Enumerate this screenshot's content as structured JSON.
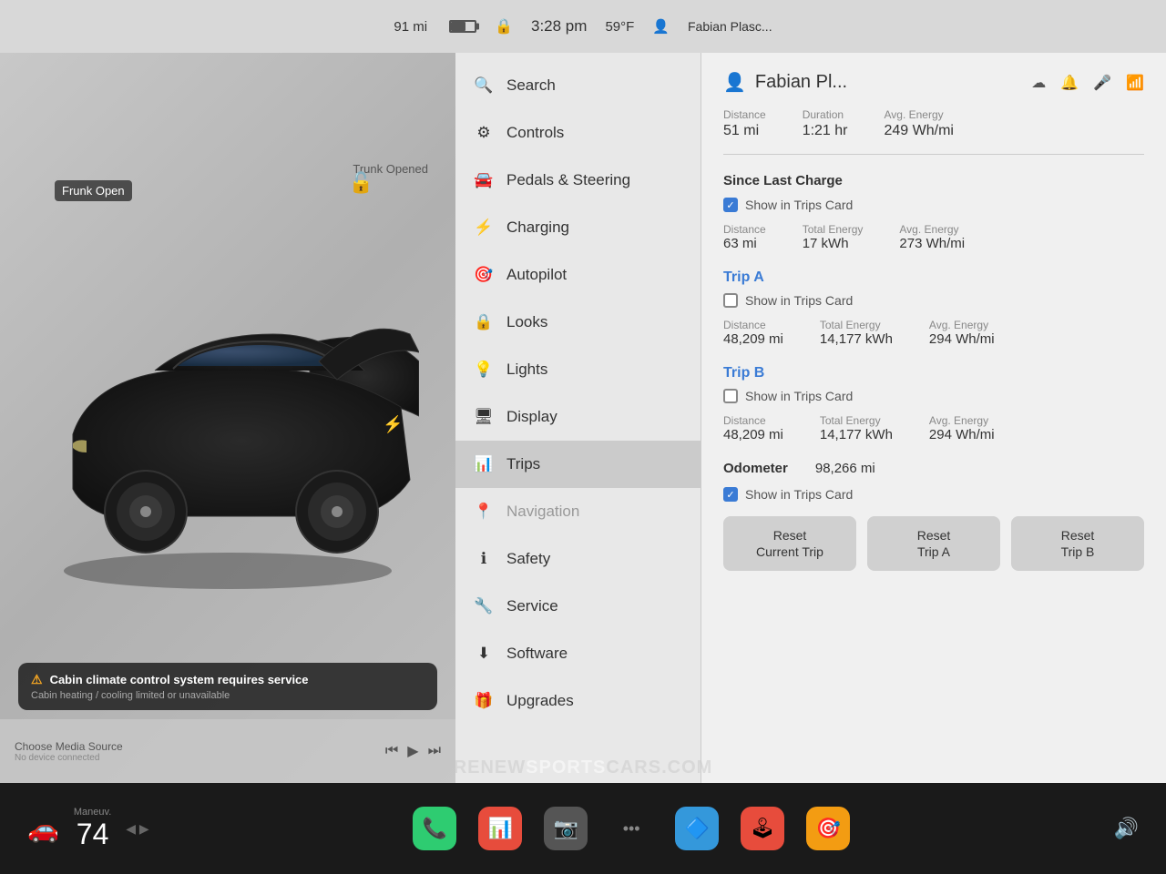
{
  "statusBar": {
    "range": "91 mi",
    "lock": "🔒",
    "time": "3:28 pm",
    "temp": "59°F",
    "user": "Fabian Plasc..."
  },
  "carPanel": {
    "frunkLabel": "Frunk\nOpen",
    "trunkLabel": "Trunk\nOpened",
    "alertTitle": "Cabin climate control system requires service",
    "alertSubtitle": "Cabin heating / cooling limited or unavailable",
    "mediaSource": "Choose Media Source",
    "mediaSubtitle": "No device connected"
  },
  "menu": {
    "items": [
      {
        "id": "search",
        "label": "Search",
        "icon": "🔍"
      },
      {
        "id": "controls",
        "label": "Controls",
        "icon": "🔘"
      },
      {
        "id": "pedals",
        "label": "Pedals & Steering",
        "icon": "🚗"
      },
      {
        "id": "charging",
        "label": "Charging",
        "icon": "⚡"
      },
      {
        "id": "autopilot",
        "label": "Autopilot",
        "icon": "🎮"
      },
      {
        "id": "looks",
        "label": "Looks",
        "icon": "🔒"
      },
      {
        "id": "lights",
        "label": "Lights",
        "icon": "💡"
      },
      {
        "id": "display",
        "label": "Display",
        "icon": "🖥"
      },
      {
        "id": "trips",
        "label": "Trips",
        "icon": "📊",
        "active": true
      },
      {
        "id": "navigation",
        "label": "Navigation",
        "icon": "📍",
        "dimmed": true
      },
      {
        "id": "safety",
        "label": "Safety",
        "icon": "ℹ"
      },
      {
        "id": "service",
        "label": "Service",
        "icon": "🔧"
      },
      {
        "id": "software",
        "label": "Software",
        "icon": "⬇"
      },
      {
        "id": "upgrades",
        "label": "Upgrades",
        "icon": "🎁"
      }
    ]
  },
  "tripsPanel": {
    "userName": "Fabian Pl...",
    "recentTrip": {
      "distance": {
        "label": "Distance",
        "value": "51 mi"
      },
      "duration": {
        "label": "Duration",
        "value": "1:21 hr"
      },
      "avgEnergy": {
        "label": "Avg. Energy",
        "value": "249 Wh/mi"
      }
    },
    "sinceLastCharge": {
      "title": "Since Last Charge",
      "showInTrips": "Show in Trips Card",
      "checked": true,
      "distance": {
        "label": "Distance",
        "value": "63 mi"
      },
      "totalEnergy": {
        "label": "Total Energy",
        "value": "17 kWh"
      },
      "avgEnergy": {
        "label": "Avg. Energy",
        "value": "273 Wh/mi"
      }
    },
    "tripA": {
      "title": "Trip A",
      "showInTrips": "Show in Trips Card",
      "checked": false,
      "distance": {
        "label": "Distance",
        "value": "48,209 mi"
      },
      "totalEnergy": {
        "label": "Total Energy",
        "value": "14,177 kWh"
      },
      "avgEnergy": {
        "label": "Avg. Energy",
        "value": "294 Wh/mi"
      }
    },
    "tripB": {
      "title": "Trip B",
      "showInTrips": "Show in Trips Card",
      "checked": false,
      "distance": {
        "label": "Distance",
        "value": "48,209 mi"
      },
      "totalEnergy": {
        "label": "Total Energy",
        "value": "14,177 kWh"
      },
      "avgEnergy": {
        "label": "Avg. Energy",
        "value": "294 Wh/mi"
      }
    },
    "odometer": {
      "label": "Odometer",
      "value": "98,266 mi",
      "showInTrips": "Show in Trips Card",
      "checked": true
    },
    "resetButtons": {
      "currentTrip": "Reset\nCurrent Trip",
      "tripA": "Reset\nTrip A",
      "tripB": "Reset\nTrip B"
    }
  },
  "taskbar": {
    "speedLabel": "Maneuv.",
    "speedValue": "74",
    "icons": [
      "📞",
      "📊",
      "📷",
      "•••",
      "🔷",
      "🕹",
      "🎯"
    ]
  },
  "watermark": {
    "prefix": "RENEW",
    "highlight": "SPORTS",
    "suffix": "CARS.COM"
  }
}
